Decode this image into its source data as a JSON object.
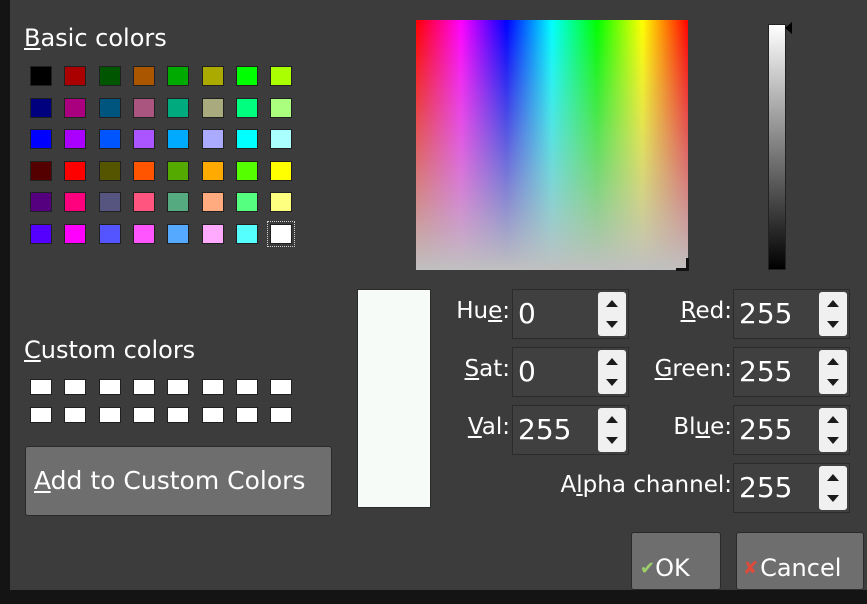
{
  "dialog": {
    "basic_colors_label": {
      "mnemonic": "B",
      "rest": "asic colors"
    },
    "custom_colors_label": {
      "mnemonic": "C",
      "rest": "ustom colors"
    },
    "add_button": {
      "mnemonic": "A",
      "rest": "dd to Custom Colors"
    },
    "ok_button": "OK",
    "cancel_button": "Cancel",
    "basic_colors": [
      [
        "#000000",
        "#aa0000",
        "#005500",
        "#aa5500",
        "#00aa00",
        "#aaaa00",
        "#00ff00",
        "#aaff00"
      ],
      [
        "#00007f",
        "#aa007f",
        "#00557f",
        "#aa557f",
        "#00aa7f",
        "#aaaa7f",
        "#00ff7f",
        "#aaff7f"
      ],
      [
        "#0000ff",
        "#aa00ff",
        "#0055ff",
        "#aa55ff",
        "#00aaff",
        "#aaaaff",
        "#00ffff",
        "#aaffff"
      ],
      [
        "#550000",
        "#ff0000",
        "#555500",
        "#ff5500",
        "#55aa00",
        "#ffaa00",
        "#55ff00",
        "#ffff00"
      ],
      [
        "#55007f",
        "#ff007f",
        "#55557f",
        "#ff557f",
        "#55aa7f",
        "#ffaa7f",
        "#55ff7f",
        "#ffff7f"
      ],
      [
        "#5500ff",
        "#ff00ff",
        "#5555ff",
        "#ff55ff",
        "#55aaff",
        "#ffaaff",
        "#55ffff",
        "#ffffff"
      ]
    ],
    "selected_basic": "#ffffff",
    "custom_colors": [
      "#ffffff",
      "#ffffff",
      "#ffffff",
      "#ffffff",
      "#ffffff",
      "#ffffff",
      "#ffffff",
      "#ffffff",
      "#ffffff",
      "#ffffff",
      "#ffffff",
      "#ffffff",
      "#ffffff",
      "#ffffff",
      "#ffffff",
      "#ffffff"
    ],
    "fields": {
      "hue": {
        "pre": "Hu",
        "mnemonic": "e",
        "post": ":",
        "value": "0"
      },
      "sat": {
        "pre": "",
        "mnemonic": "S",
        "post": "at:",
        "value": "0"
      },
      "val": {
        "pre": "",
        "mnemonic": "V",
        "post": "al:",
        "value": "255"
      },
      "red": {
        "pre": "",
        "mnemonic": "R",
        "post": "ed:",
        "value": "255"
      },
      "green": {
        "pre": "",
        "mnemonic": "G",
        "post": "reen:",
        "value": "255"
      },
      "blue": {
        "pre": "Bl",
        "mnemonic": "u",
        "post": "e:",
        "value": "255"
      },
      "alpha": {
        "pre": "A",
        "mnemonic": "l",
        "post": "pha channel:",
        "value": "255"
      }
    },
    "preview_color": "#f6fbf8",
    "icons": {
      "ok": "ok-checkmark-icon",
      "cancel": "cancel-x-icon"
    }
  }
}
